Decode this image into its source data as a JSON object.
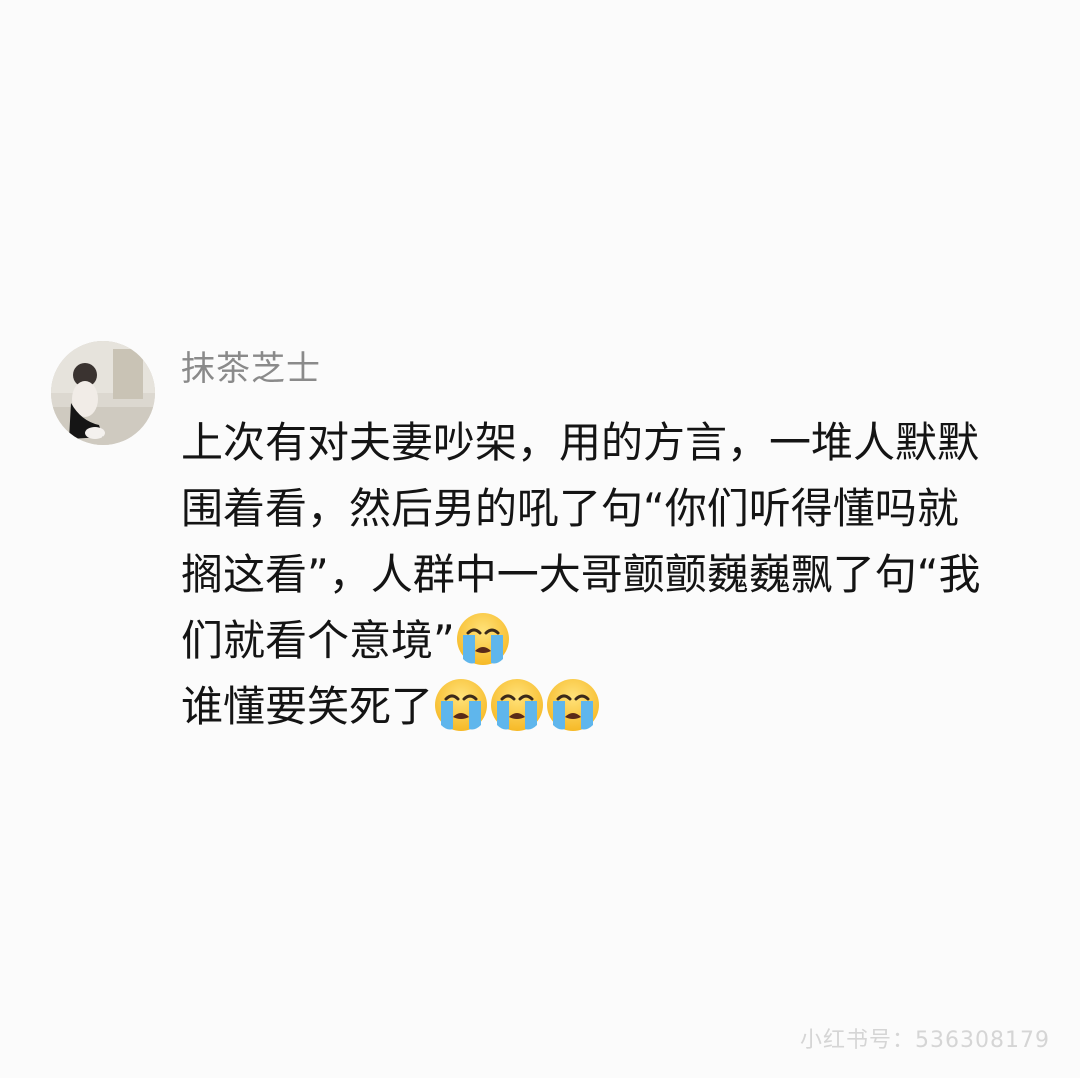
{
  "comment": {
    "username": "抹茶芝士",
    "lines": [
      "上次有对夫妻吵架，用的方言，一堆人默默",
      "围着看，然后男的吼了句“你们听得懂吗就",
      "搁这看”，人群中一大哥颤颤巍巍飘了句“我",
      "们就看个意境”",
      "谁懂要笑死了"
    ],
    "emoji_name": "loudly-crying-face"
  },
  "watermark": {
    "text": "小红书号：536308179"
  },
  "colors": {
    "background": "#fbfbfb",
    "username": "#8a8a8a",
    "body_text": "#141414",
    "watermark": "#d5d5d5",
    "emoji_yellow": "#f9c22e",
    "emoji_tears": "#5fb6ec"
  }
}
